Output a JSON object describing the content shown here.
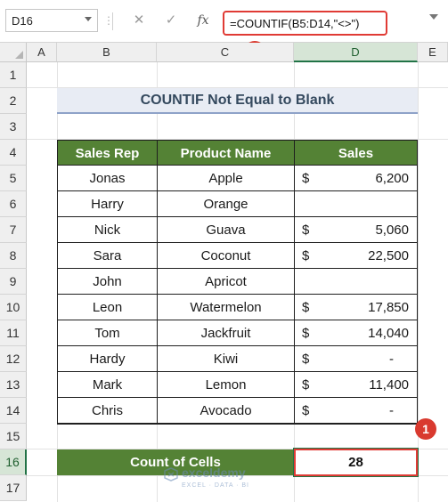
{
  "formula_bar": {
    "name_box": "D16",
    "cancel_icon": "✕",
    "enter_icon": "✓",
    "fx_label": "fx",
    "formula": "=COUNTIF(B5:D14,\"<>\")"
  },
  "annotations": {
    "badge_formula": "2",
    "badge_cell": "1"
  },
  "columns": [
    "A",
    "B",
    "C",
    "D",
    "E"
  ],
  "selected_column": "D",
  "rows": [
    "1",
    "2",
    "3",
    "4",
    "5",
    "6",
    "7",
    "8",
    "9",
    "10",
    "11",
    "12",
    "13",
    "14",
    "15",
    "16",
    "17"
  ],
  "selected_row": "16",
  "title": "COUNTIF Not Equal to Blank",
  "table": {
    "headers": [
      "Sales Rep",
      "Product Name",
      "Sales"
    ],
    "rows": [
      {
        "rep": "Jonas",
        "product": "Apple",
        "currency": "$",
        "sales": "6,200"
      },
      {
        "rep": "Harry",
        "product": "Orange",
        "currency": "",
        "sales": ""
      },
      {
        "rep": "Nick",
        "product": "Guava",
        "currency": "$",
        "sales": "5,060"
      },
      {
        "rep": "Sara",
        "product": "Coconut",
        "currency": "$",
        "sales": "22,500"
      },
      {
        "rep": "John",
        "product": "Apricot",
        "currency": "",
        "sales": ""
      },
      {
        "rep": "Leon",
        "product": "Watermelon",
        "currency": "$",
        "sales": "17,850"
      },
      {
        "rep": "Tom",
        "product": "Jackfruit",
        "currency": "$",
        "sales": "14,040"
      },
      {
        "rep": "Hardy",
        "product": "Kiwi",
        "currency": "$",
        "sales": "-"
      },
      {
        "rep": "Mark",
        "product": "Lemon",
        "currency": "$",
        "sales": "11,400"
      },
      {
        "rep": "Chris",
        "product": "Avocado",
        "currency": "$",
        "sales": "-"
      }
    ]
  },
  "result": {
    "label": "Count of Cells",
    "value": "28"
  },
  "watermark": {
    "name": "exceldemy",
    "tagline": "EXCEL · DATA · BI"
  },
  "colors": {
    "header_green": "#548235",
    "highlight_red": "#e03b35",
    "title_bg": "#e8ecf4"
  }
}
